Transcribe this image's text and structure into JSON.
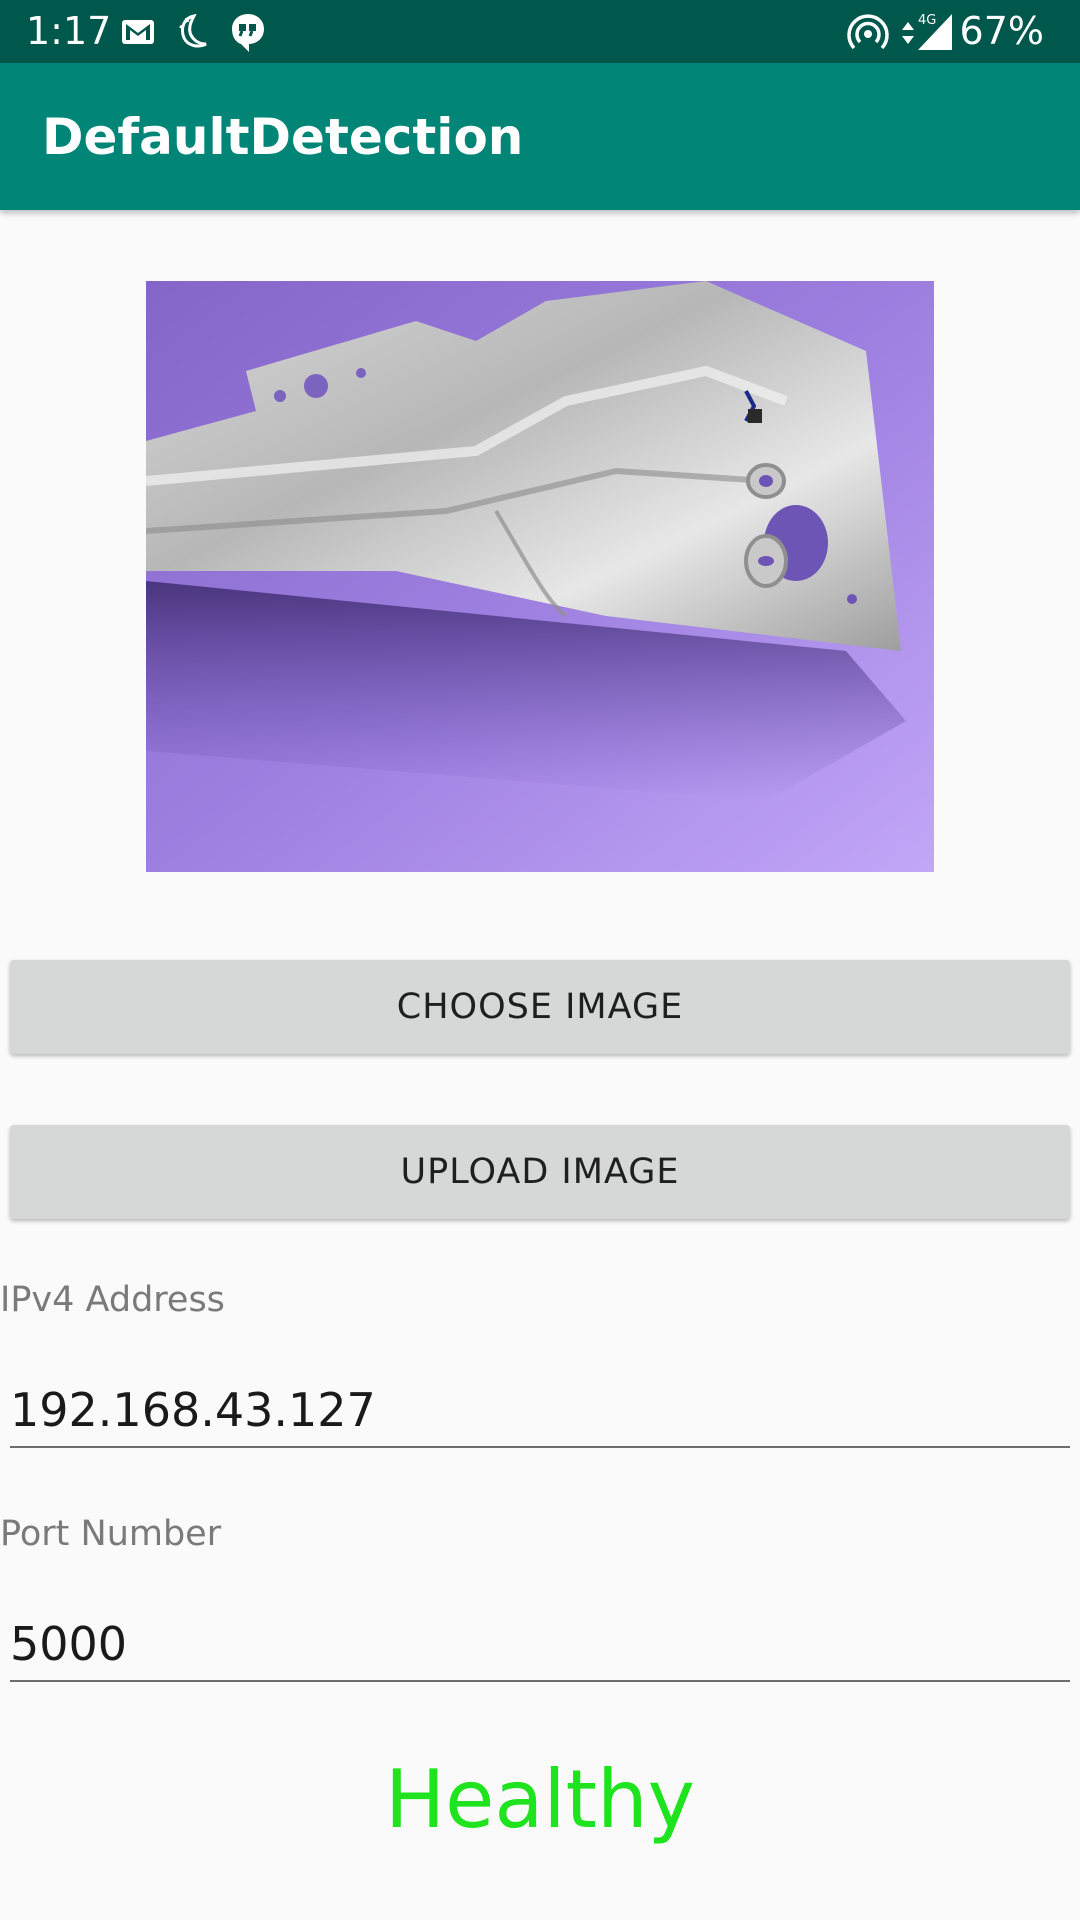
{
  "status_bar": {
    "time": "1:17",
    "battery": "67%",
    "network": "4G",
    "icons": [
      "gmail-icon",
      "moon-icon",
      "quote-bubble-icon",
      "hotspot-icon",
      "data-arrows-icon",
      "signal-icon"
    ]
  },
  "app_bar": {
    "title": "DefaultDetection",
    "color": "#008577",
    "status_color": "#00574b"
  },
  "preview": {
    "subject": "metal-part-photo"
  },
  "buttons": {
    "choose": "CHOOSE IMAGE",
    "upload": "UPLOAD IMAGE"
  },
  "ip": {
    "label": "IPv4 Address",
    "value": "192.168.43.127"
  },
  "port": {
    "label": "Port Number",
    "value": "5000"
  },
  "result": {
    "text": "Healthy",
    "color": "#1ee31e"
  }
}
